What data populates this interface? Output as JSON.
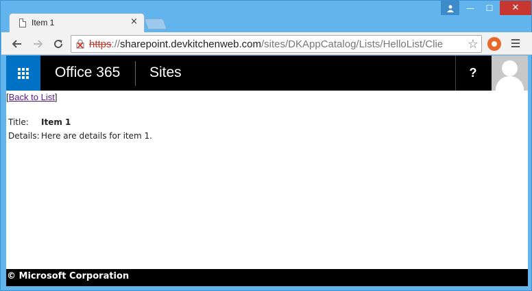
{
  "browser": {
    "tab_title": "Item 1",
    "tab_close": "×",
    "url_scheme": "https",
    "url_sep": "://",
    "url_host": "sharepoint.devkitchenweb.com",
    "url_path": "/sites/DKAppCatalog/Lists/HelloList/Clie",
    "window_close": "✕",
    "window_min": "—",
    "window_max": "☐"
  },
  "suitebar": {
    "brand": "Office 365",
    "section": "Sites",
    "help": "?"
  },
  "page": {
    "back_open": "[",
    "back_link": "Back to List",
    "back_close": "]",
    "fields": [
      {
        "label": "Title:",
        "value": "Item 1"
      },
      {
        "label": "Details:",
        "value": "Here are details for item 1."
      }
    ],
    "footer": "© Microsoft Corporation"
  },
  "colors": {
    "accent": "#0072c6",
    "suitebar": "#000000",
    "browser_frame": "#61b4ec"
  }
}
